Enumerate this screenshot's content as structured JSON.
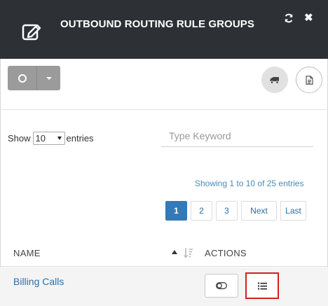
{
  "header": {
    "title": "OUTBOUND ROUTING RULE GROUPS",
    "close_glyph": "✖"
  },
  "icons": {
    "edit": "edit-icon",
    "refresh": "refresh-icon",
    "close": "close-icon",
    "split_main": "circle-icon",
    "split_caret": "chevron-down-icon",
    "truck": "truck-icon",
    "document": "document-icon",
    "sort": "sort-icon",
    "toggle": "toggle-icon",
    "list": "list-icon"
  },
  "controls": {
    "show_label": "Show",
    "entries_value": "10",
    "entries_label": "entries",
    "search_placeholder": "Type Keyword"
  },
  "info": "Showing 1 to 10 of 25 entries",
  "pagination": {
    "pages": [
      "1",
      "2",
      "3"
    ],
    "active": "1",
    "next": "Next",
    "last": "Last"
  },
  "table": {
    "columns": [
      "NAME",
      "ACTIONS"
    ],
    "rows": [
      {
        "name": "Billing Calls"
      }
    ]
  },
  "colors": {
    "header_bg": "#2d3136",
    "link": "#2a6fa8",
    "active_page": "#337ab7",
    "highlight": "#d32020"
  }
}
